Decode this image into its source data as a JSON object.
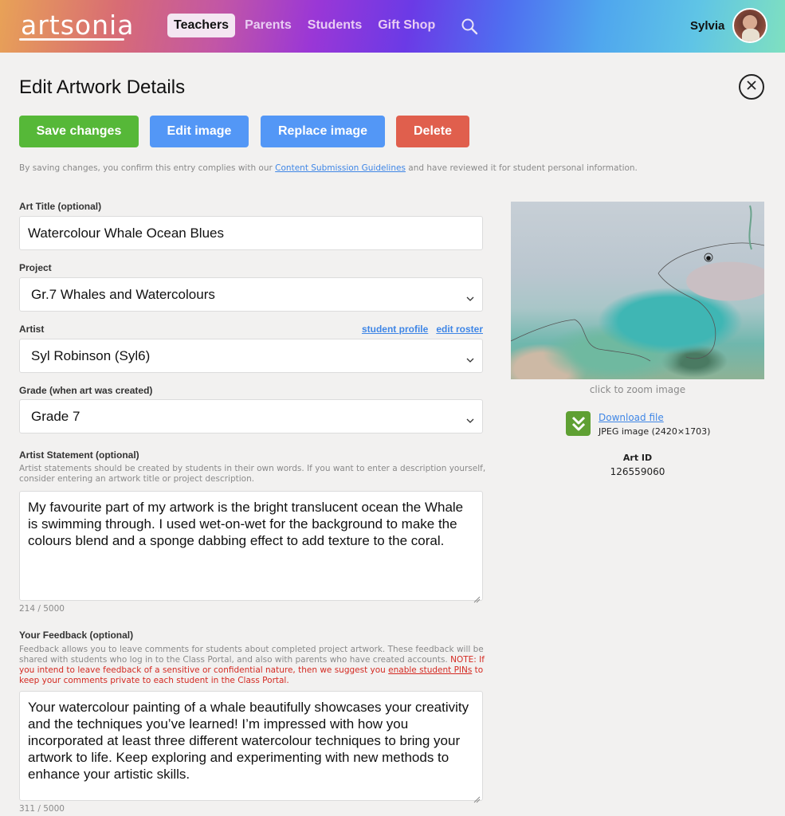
{
  "header": {
    "logo": "artsonia",
    "nav": [
      {
        "label": "Teachers",
        "active": true
      },
      {
        "label": "Parents",
        "active": false
      },
      {
        "label": "Students",
        "active": false
      },
      {
        "label": "Gift Shop",
        "active": false
      }
    ],
    "search_icon": "search-icon",
    "user_name": "Sylvia"
  },
  "page": {
    "title": "Edit Artwork Details",
    "close_icon": "close-circle-icon"
  },
  "actions": {
    "save_label": "Save changes",
    "edit_image_label": "Edit image",
    "replace_image_label": "Replace image",
    "delete_label": "Delete",
    "colors": {
      "save": "#56b838",
      "edit": "#5397f6",
      "replace": "#5397f6",
      "delete": "#e05f4d"
    }
  },
  "confirm_note": {
    "before": "By saving changes, you confirm this entry complies with our ",
    "link": "Content Submission Guidelines",
    "after": " and have reviewed it for student personal information."
  },
  "form": {
    "art_title": {
      "label": "Art Title (optional)",
      "value": "Watercolour Whale Ocean Blues"
    },
    "project": {
      "label": "Project",
      "value": "Gr.7 Whales and Watercolours"
    },
    "artist": {
      "label": "Artist",
      "value": "Syl Robinson (Syl6)",
      "student_profile_link": "student profile",
      "edit_roster_link": "edit roster"
    },
    "grade": {
      "label": "Grade (when art was created)",
      "value": "Grade 7"
    },
    "artist_statement": {
      "label": "Artist Statement (optional)",
      "help": "Artist statements should be created by students in their own words. If you want to enter a description yourself, consider entering an artwork title or project description.",
      "value": "My favourite part of my artwork is the bright translucent ocean the Whale is swimming through. I used wet-on-wet for the background to make the colours blend and a sponge dabbing effect to add texture to the coral.",
      "counter": "214 / 5000"
    },
    "feedback": {
      "label": "Your Feedback (optional)",
      "help": "Feedback allows you to leave comments for students about completed project artwork. These feedback will be shared with students who log in to the Class Portal, and also with parents who have created accounts.",
      "note_before": "NOTE: If you intend to leave feedback of a sensitive or confidential nature, then we suggest you ",
      "note_link": "enable student PINs",
      "note_after": " to keep your comments private to each student in the Class Portal.",
      "value": "Your watercolour painting of a whale beautifully showcases your creativity and the techniques you’ve learned! I’m impressed with how you incorporated at least three different watercolour techniques to bring your artwork to life. Keep exploring and experimenting with new methods to enhance your artistic skills.",
      "counter": "311 / 5000"
    }
  },
  "artwork_panel": {
    "image_alt": "Watercolour painting of a whale swimming in a turquoise ocean",
    "zoom_caption": "click to zoom image",
    "download_link": "Download file",
    "file_meta": "JPEG image (2420×1703)",
    "art_id_label": "Art ID",
    "art_id_value": "126559060"
  }
}
